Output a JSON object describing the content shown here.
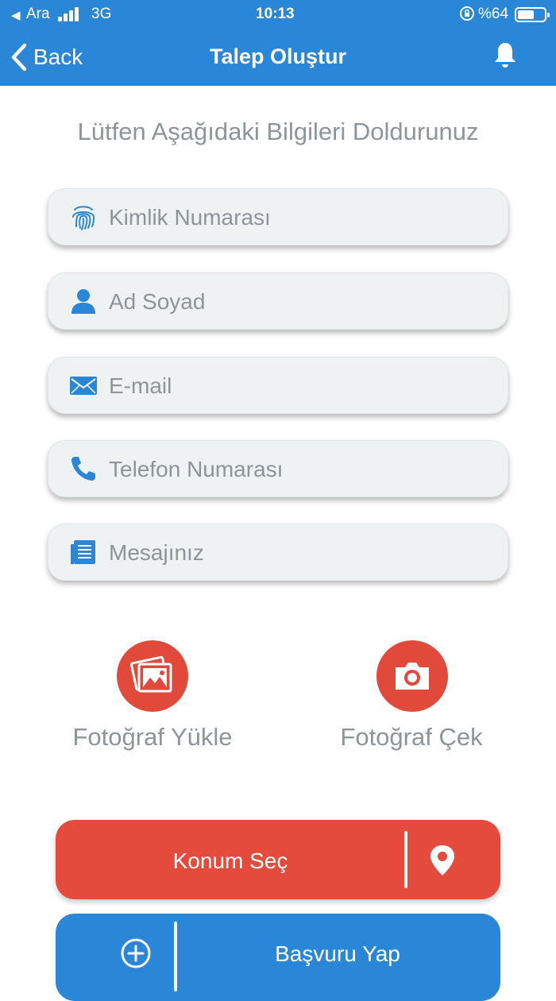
{
  "status_bar": {
    "carrier": "Ara",
    "network": "3G",
    "time": "10:13",
    "battery": "%64",
    "battery_level": 0.64
  },
  "nav": {
    "back_label": "Back",
    "title": "Talep Oluştur",
    "bell_icon": "bell-icon"
  },
  "form": {
    "subtitle": "Lütfen Aşağıdaki Bilgileri Doldurunuz",
    "fields": [
      {
        "placeholder": "Kimlik Numarası",
        "value": "",
        "icon": "fingerprint-icon"
      },
      {
        "placeholder": "Ad Soyad",
        "value": "",
        "icon": "user-icon"
      },
      {
        "placeholder": "E-mail",
        "value": "",
        "icon": "envelope-icon"
      },
      {
        "placeholder": "Telefon Numarası",
        "value": "",
        "icon": "phone-icon"
      },
      {
        "placeholder": "Mesajınız",
        "value": "",
        "icon": "message-icon"
      }
    ]
  },
  "photos": {
    "upload_label": "Fotoğraf Yükle",
    "capture_label": "Fotoğraf Çek"
  },
  "actions": {
    "location_label": "Konum Seç",
    "submit_label": "Başvuru Yap"
  },
  "colors": {
    "header": "#2a86d6",
    "accent_red": "#e44b3c",
    "icon_blue": "#2a86d6",
    "field_bg": "#eff2f3",
    "muted_text": "#8d959b"
  }
}
